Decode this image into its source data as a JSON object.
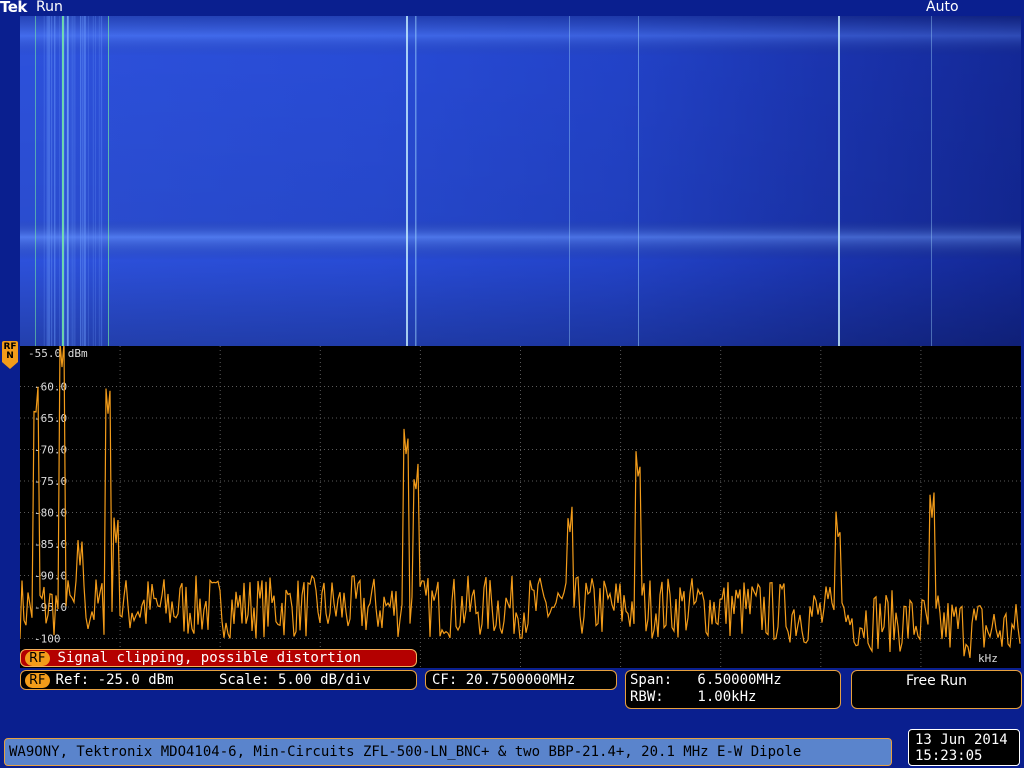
{
  "header": {
    "brand": "Tek",
    "run_state": "Run",
    "trigger_mode": "Auto"
  },
  "channel_marker": {
    "label_top": "RF",
    "label_bottom": "N"
  },
  "spectrum": {
    "ref_level_label": "-55.0 dBm",
    "freq_unit_label": "kHz",
    "y_ticks": [
      "-60.0",
      "-65.0",
      "-70.0",
      "-75.0",
      "-80.0",
      "-85.0",
      "-90.0",
      "-95.0",
      "-100"
    ],
    "peaks": [
      {
        "frac": 0.015,
        "level": -66.0
      },
      {
        "frac": 0.042,
        "level": -57.0
      },
      {
        "frac": 0.088,
        "level": -64.5
      },
      {
        "frac": 0.096,
        "level": -85.0
      },
      {
        "frac": 0.06,
        "level": -88.5
      },
      {
        "frac": 0.386,
        "level": -71.5
      },
      {
        "frac": 0.395,
        "level": -77.5
      },
      {
        "frac": 0.549,
        "level": -84.0
      },
      {
        "frac": 0.618,
        "level": -75.5
      },
      {
        "frac": 0.818,
        "level": -85.5
      },
      {
        "frac": 0.911,
        "level": -81.0
      }
    ]
  },
  "status": {
    "warning_badge": "RF",
    "warning_text": "Signal clipping, possible distortion",
    "ref_badge": "RF",
    "ref_text": "Ref: -25.0 dBm",
    "scale_text": "Scale: 5.00 dB/div",
    "cf_text": "CF: 20.7500000MHz",
    "span_text": "Span:   6.50000MHz",
    "rbw_text": "RBW:    1.00kHz",
    "acq_mode": "Free Run"
  },
  "footer": {
    "caption": "WA9ONY, Tektronix MDO4104-6, Min-Circuits ZFL-500-LN_BNC+ & two BBP-21.4+, 20.1 MHz E-W Dipole",
    "date": "13 Jun 2014",
    "time": "15:23:05"
  },
  "colors": {
    "frame_blue": "#0a1f8f",
    "trace_orange": "#f39c1a",
    "warning_red": "#b40000",
    "caption_blue": "#5a84cc"
  }
}
